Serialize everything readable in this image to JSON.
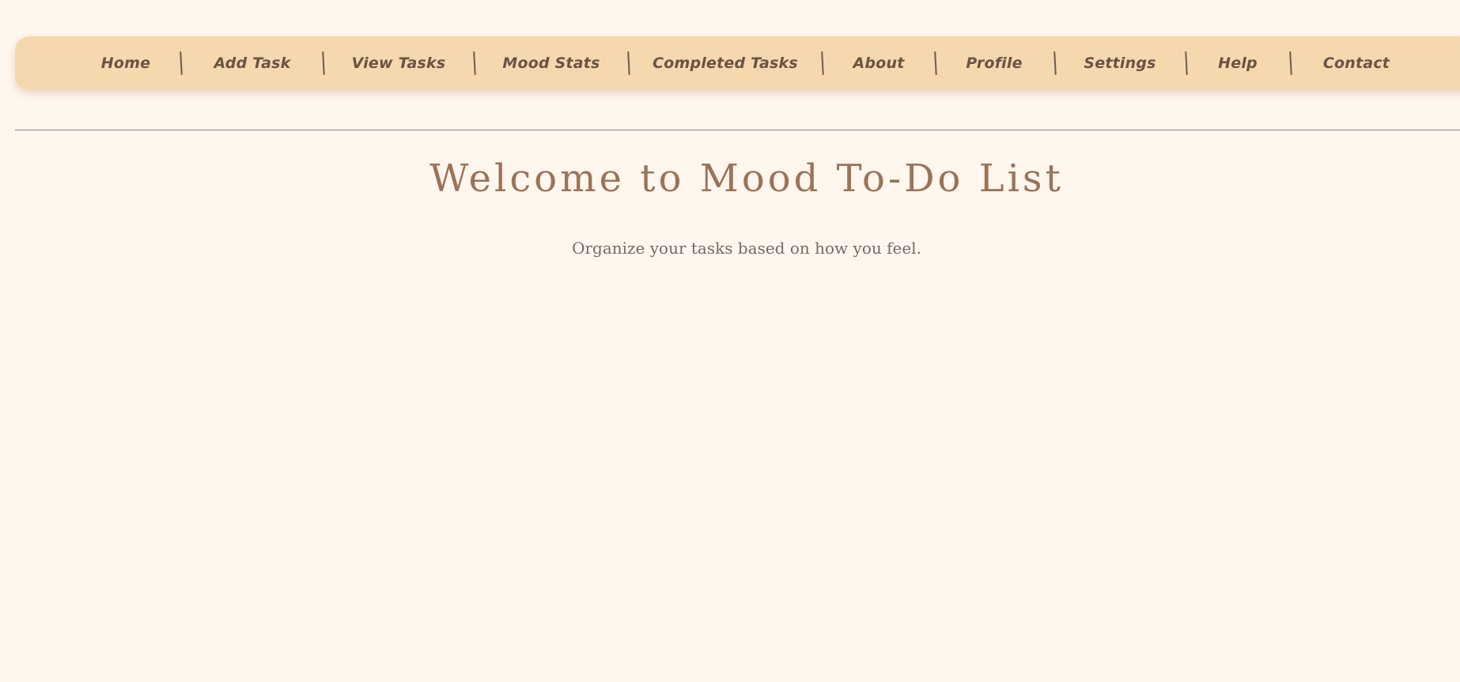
{
  "nav": {
    "items": [
      {
        "label": "Home"
      },
      {
        "label": "Add Task"
      },
      {
        "label": "View Tasks"
      },
      {
        "label": "Mood Stats"
      },
      {
        "label": "Completed Tasks"
      },
      {
        "label": "About"
      },
      {
        "label": "Profile"
      },
      {
        "label": "Settings"
      },
      {
        "label": "Help"
      },
      {
        "label": "Contact"
      }
    ],
    "separator": "|"
  },
  "main": {
    "title": "Welcome to Mood To-Do List",
    "subtitle": "Organize your tasks based on how you feel."
  },
  "colors": {
    "background": "#fff6ee",
    "navbar": "#f6d8ae",
    "nav_text": "#6b5344",
    "title": "#9b7356",
    "subtitle": "#726a66"
  }
}
